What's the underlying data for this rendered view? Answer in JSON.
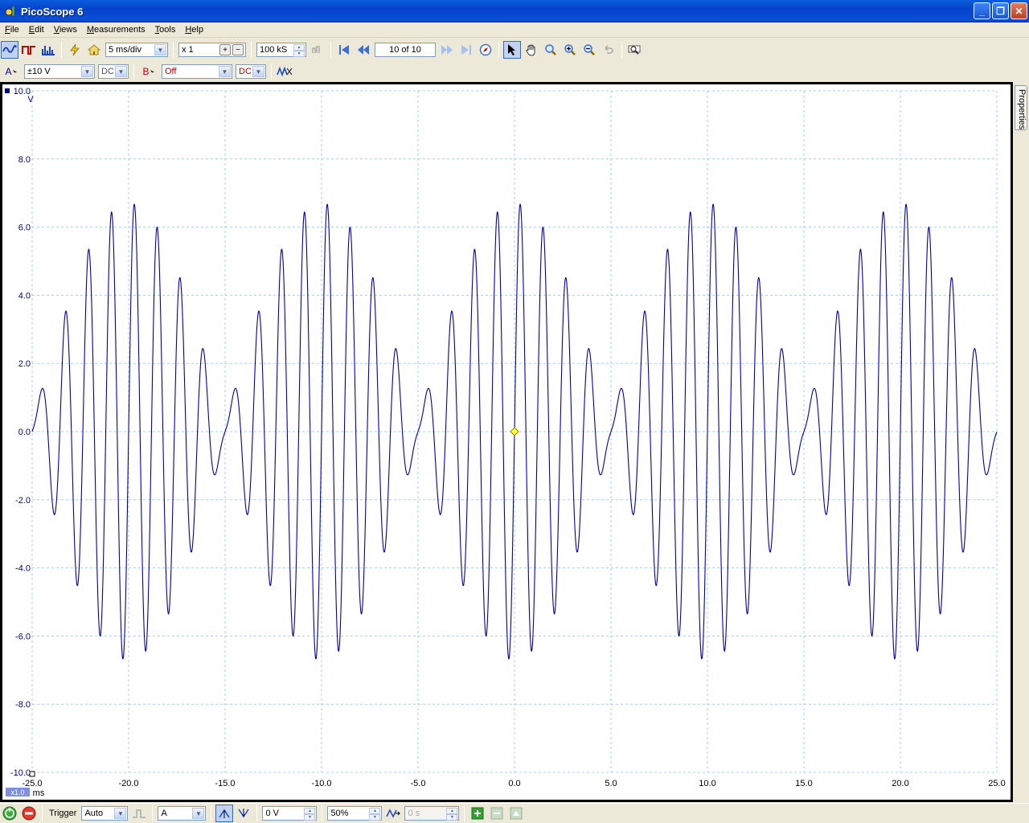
{
  "window": {
    "title": "PicoScope 6"
  },
  "menu": [
    {
      "key": "file",
      "label": "File"
    },
    {
      "key": "edit",
      "label": "Edit"
    },
    {
      "key": "views",
      "label": "Views"
    },
    {
      "key": "measurements",
      "label": "Measurements"
    },
    {
      "key": "tools",
      "label": "Tools"
    },
    {
      "key": "help",
      "label": "Help"
    }
  ],
  "toolbar": {
    "timebase": "5 ms/div",
    "zoom_factor": "x 1",
    "samples": "100 kS",
    "buffer": "10 of 10"
  },
  "channels": {
    "a": {
      "label": "A",
      "range": "±10 V",
      "coupling": "DC",
      "color": "#00008b"
    },
    "b": {
      "label": "B",
      "range": "Off",
      "coupling": "DC",
      "color": "#c00000"
    }
  },
  "status": {
    "trigger_label": "Trigger",
    "trigger_mode": "Auto",
    "trigger_source": "A",
    "threshold": "0 V",
    "pretrigger": "50%",
    "delay": "0 s"
  },
  "properties_tab": "Properties",
  "chart_data": {
    "type": "line",
    "ylabel": "V",
    "xlabel": "ms",
    "xlim": [
      -25,
      25
    ],
    "ylim": [
      -10,
      10
    ],
    "x_ticks": [
      "-25.0",
      "-20.0",
      "-15.0",
      "-10.0",
      "-5.0",
      "0.0",
      "5.0",
      "10.0",
      "15.0",
      "20.0",
      "25.0"
    ],
    "y_ticks": [
      "10.0",
      "8.0",
      "6.0",
      "4.0",
      "2.0",
      "0.0",
      "-2.0",
      "-4.0",
      "-6.0",
      "-8.0",
      "-10.0"
    ],
    "zoom_badge": "x1.0",
    "grid": true,
    "series": [
      {
        "color": "#0000b0",
        "components": [
          {
            "amplitude": 3.7,
            "freq_khz": 0.8
          },
          {
            "amplitude": 3.0,
            "freq_khz": 0.9
          }
        ]
      }
    ]
  }
}
